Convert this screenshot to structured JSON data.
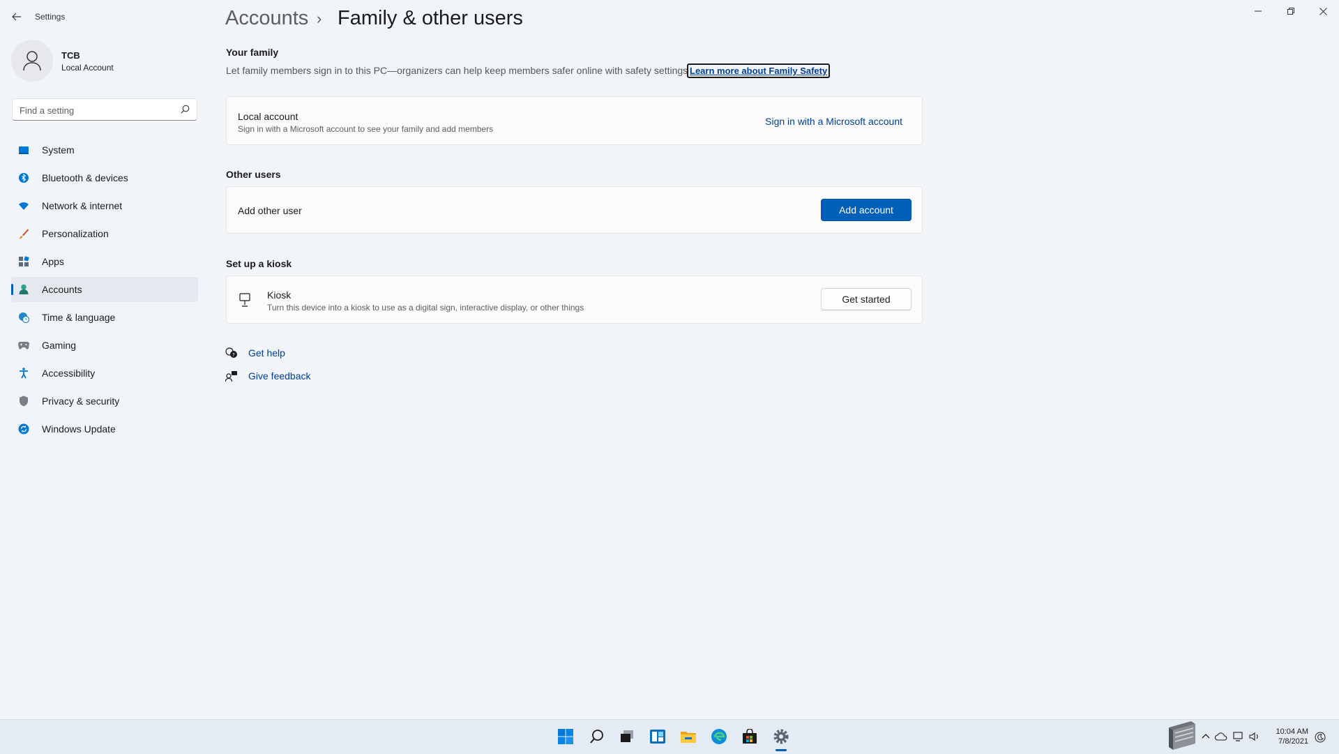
{
  "window": {
    "app_title": "Settings",
    "controls": [
      "minimize-icon",
      "restore-icon",
      "close-icon"
    ]
  },
  "profile": {
    "name": "TCB",
    "account_type": "Local Account"
  },
  "search": {
    "placeholder": "Find a setting"
  },
  "sidebar": {
    "items": [
      {
        "label": "System",
        "icon": "system-icon",
        "active": false
      },
      {
        "label": "Bluetooth & devices",
        "icon": "bluetooth-icon",
        "active": false
      },
      {
        "label": "Network & internet",
        "icon": "wifi-icon",
        "active": false
      },
      {
        "label": "Personalization",
        "icon": "brush-icon",
        "active": false
      },
      {
        "label": "Apps",
        "icon": "apps-icon",
        "active": false
      },
      {
        "label": "Accounts",
        "icon": "person-icon",
        "active": true
      },
      {
        "label": "Time & language",
        "icon": "globe-clock-icon",
        "active": false
      },
      {
        "label": "Gaming",
        "icon": "gamepad-icon",
        "active": false
      },
      {
        "label": "Accessibility",
        "icon": "accessibility-icon",
        "active": false
      },
      {
        "label": "Privacy & security",
        "icon": "shield-icon",
        "active": false
      },
      {
        "label": "Windows Update",
        "icon": "update-icon",
        "active": false
      }
    ]
  },
  "header": {
    "breadcrumb_parent": "Accounts",
    "breadcrumb_separator": "›",
    "title": "Family & other users"
  },
  "family": {
    "section_title": "Your family",
    "description": "Let family members sign in to this PC—organizers can help keep members safer online with safety settings",
    "learn_more": "Learn more about Family Safety",
    "card": {
      "title": "Local account",
      "subtitle": "Sign in with a Microsoft account to see your family and add members",
      "action": "Sign in with a Microsoft account"
    }
  },
  "other_users": {
    "section_title": "Other users",
    "card": {
      "title": "Add other user",
      "action": "Add account"
    }
  },
  "kiosk": {
    "section_title": "Set up a kiosk",
    "card": {
      "title": "Kiosk",
      "subtitle": "Turn this device into a kiosk to use as a digital sign, interactive display, or other things",
      "action": "Get started"
    }
  },
  "help": {
    "get_help": "Get help",
    "give_feedback": "Give feedback"
  },
  "taskbar": {
    "apps": [
      "windows-start-icon",
      "search-icon",
      "task-view-icon",
      "widgets-icon",
      "file-explorer-icon",
      "edge-icon",
      "store-icon",
      "settings-icon"
    ],
    "clock_time": "10:04 AM",
    "clock_date": "7/8/2021"
  },
  "colors": {
    "accent": "#005fb8",
    "link": "#003e92",
    "background": "#f1f4f9",
    "card": "#fbfbfb"
  }
}
